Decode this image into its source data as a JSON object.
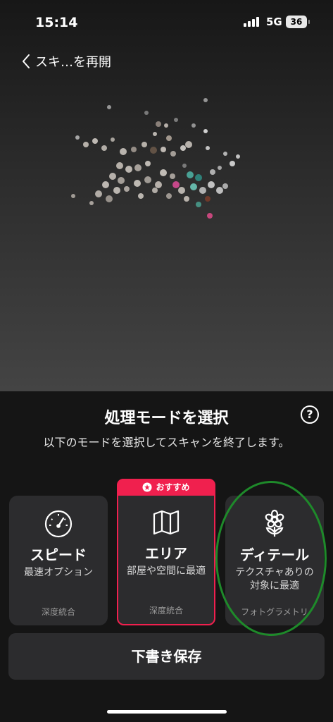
{
  "status_bar": {
    "time": "15:14",
    "network": "5G",
    "battery": "36"
  },
  "nav": {
    "back_label": "スキ…を再開"
  },
  "sheet": {
    "title": "処理モードを選択",
    "description": "以下のモードを選択してスキャンを終了します。",
    "modes": [
      {
        "name": "スピード",
        "desc": "最速オプション",
        "foot": "深度統合",
        "icon": "speedometer-icon"
      },
      {
        "badge": "おすすめ",
        "name": "エリア",
        "desc": "部屋や空間に最適",
        "foot": "深度統合",
        "icon": "map-icon"
      },
      {
        "name": "ディテール",
        "desc": "テクスチャありの対象に最適",
        "foot": "フォトグラメトリ",
        "icon": "flower-icon"
      }
    ],
    "save_label": "下書き保存"
  },
  "colors": {
    "accent": "#f0204e",
    "annotation": "#1e8a2a",
    "card": "#2c2c2e"
  }
}
